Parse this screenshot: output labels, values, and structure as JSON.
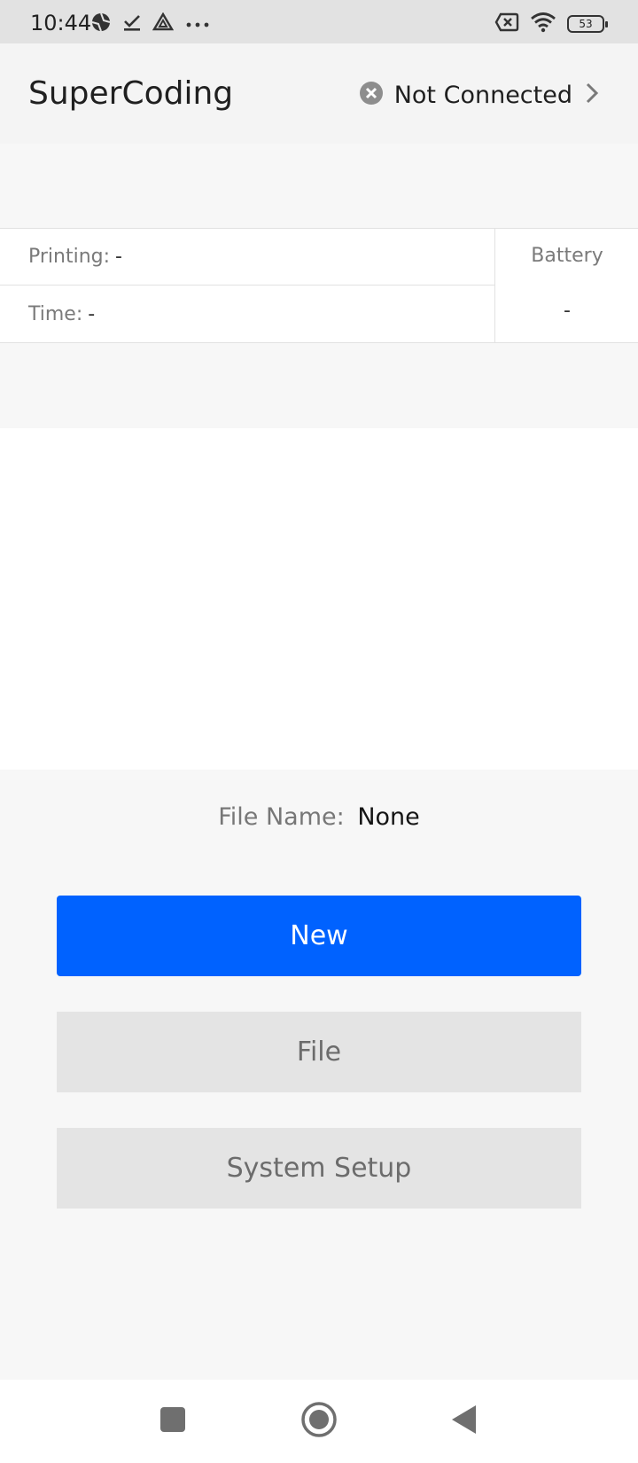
{
  "status_bar": {
    "time": "10:44",
    "left_icons": [
      "aperture-icon",
      "check-icon",
      "drive-icon",
      "more-dots-icon"
    ],
    "right_icons": [
      "sim-off-icon",
      "wifi-icon"
    ],
    "battery_level": "53"
  },
  "header": {
    "title": "SuperCoding",
    "connection": {
      "icon": "close-circle-icon",
      "status": "Not Connected",
      "chevron": "chevron-right-icon"
    }
  },
  "info": {
    "printing_label": "Printing:",
    "printing_value": "-",
    "time_label": "Time:",
    "time_value": "-",
    "battery_label": "Battery",
    "battery_value": "-"
  },
  "file": {
    "label": "File Name:",
    "value": "None"
  },
  "actions": {
    "new_label": "New",
    "file_label": "File",
    "setup_label": "System Setup"
  },
  "nav": {
    "icons": [
      "recents-square-icon",
      "home-circle-icon",
      "back-triangle-icon"
    ]
  },
  "colors": {
    "primary": "#0062ff",
    "secondary_button": "#e4e4e4",
    "secondary_text": "#6c6c6c",
    "background": "#f7f7f7"
  }
}
